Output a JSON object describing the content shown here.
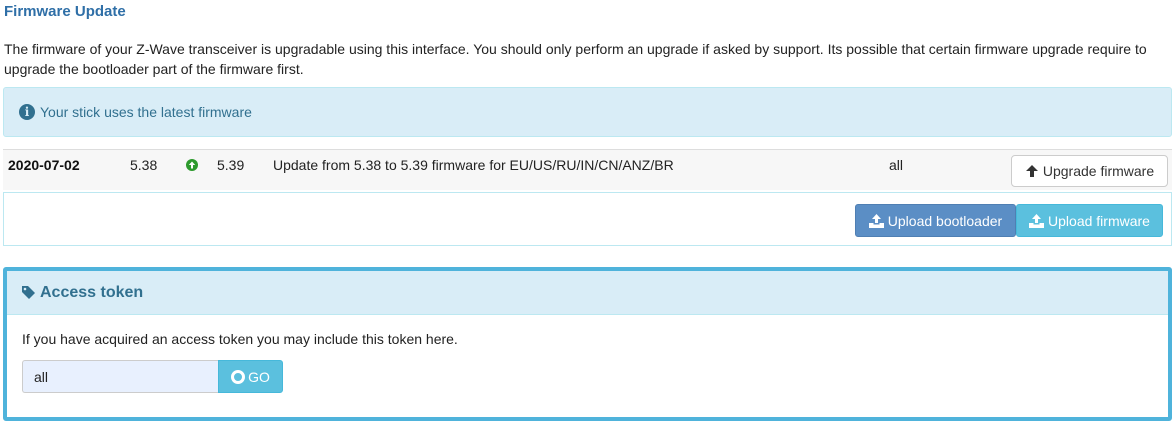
{
  "header": {
    "title": "Firmware Update",
    "intro": "The firmware of your Z-Wave transceiver is upgradable using this interface. You should only perform an upgrade if asked by support. Its possible that certain firmware upgrade require to upgrade the bootloader part of the firmware first."
  },
  "alert": {
    "icon": "info-icon",
    "text": "Your stick uses the latest firmware"
  },
  "firmware_rows": [
    {
      "date": "2020-07-02",
      "from_version": "5.38",
      "to_version": "5.39",
      "description": "Update from 5.38 to 5.39 firmware for EU/US/RU/IN/CN/ANZ/BR",
      "region": "all",
      "button_label": "Upgrade firmware",
      "button_icon": "arrow-up-icon"
    }
  ],
  "upload": {
    "bootloader_label": "Upload bootloader",
    "firmware_label": "Upload firmware",
    "icon": "upload-icon"
  },
  "access_token": {
    "title": "Access token",
    "title_icon": "tag-icon",
    "description": "If you have acquired an access token you may include this token here.",
    "input_value": "all",
    "go_label": "GO"
  },
  "colors": {
    "title_blue": "#2f6fa7",
    "info_bg": "#d9edf7",
    "info_text": "#31708f",
    "primary_btn": "#5b8ec5",
    "info_btn": "#5bc0de",
    "success_green": "#2d9a2d",
    "panel_border": "#4fb3db"
  }
}
